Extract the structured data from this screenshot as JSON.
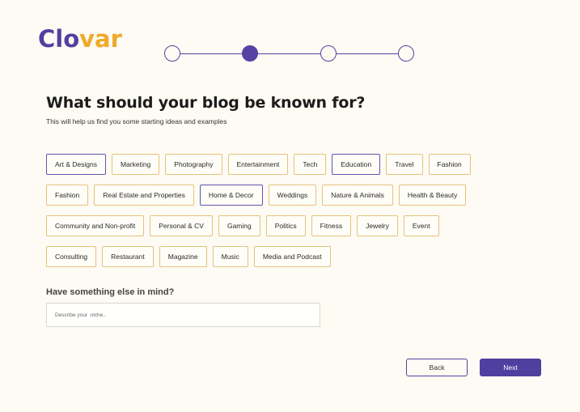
{
  "logo": {
    "part1": "Clo",
    "part2": "var"
  },
  "stepper": {
    "steps": 4,
    "current": 2
  },
  "heading": {
    "title": "What should your blog be known for?",
    "subtitle": "This will help us find you some starting ideas and examples"
  },
  "categories": {
    "rows": [
      [
        {
          "label": "Art & Designs",
          "selected": true
        },
        {
          "label": "Marketing",
          "selected": false
        },
        {
          "label": "Photography",
          "selected": false
        },
        {
          "label": "Entertainment",
          "selected": false
        },
        {
          "label": "Tech",
          "selected": false
        },
        {
          "label": "Education",
          "selected": true
        },
        {
          "label": "Travel",
          "selected": false
        },
        {
          "label": "Fashion",
          "selected": false
        }
      ],
      [
        {
          "label": "Fashion",
          "selected": false
        },
        {
          "label": "Real Estate and Properties",
          "selected": false
        },
        {
          "label": "Home & Decor",
          "selected": true
        },
        {
          "label": "Weddings",
          "selected": false
        },
        {
          "label": "Nature & Animals",
          "selected": false
        },
        {
          "label": "Health & Beauty",
          "selected": false
        }
      ],
      [
        {
          "label": "Community and Non-profit",
          "selected": false
        },
        {
          "label": "Personal & CV",
          "selected": false
        },
        {
          "label": "Gaming",
          "selected": false
        },
        {
          "label": "Politics",
          "selected": false
        },
        {
          "label": "Fitness",
          "selected": false
        },
        {
          "label": "Jewelry",
          "selected": false
        },
        {
          "label": "Event",
          "selected": false
        }
      ],
      [
        {
          "label": "Consulting",
          "selected": false
        },
        {
          "label": "Restaurant",
          "selected": false
        },
        {
          "label": "Magazine",
          "selected": false
        },
        {
          "label": "Music",
          "selected": false
        },
        {
          "label": "Media and Podcast",
          "selected": false
        }
      ]
    ]
  },
  "custom": {
    "question": "Have something else in mind?",
    "placeholder": "Describe your  niche..",
    "value": ""
  },
  "actions": {
    "back": "Back",
    "next": "Next"
  },
  "colors": {
    "primary": "#4f3f9e",
    "accent": "#f0a92b",
    "chip_border": "#e6c27c",
    "background": "#fdfbf3"
  }
}
